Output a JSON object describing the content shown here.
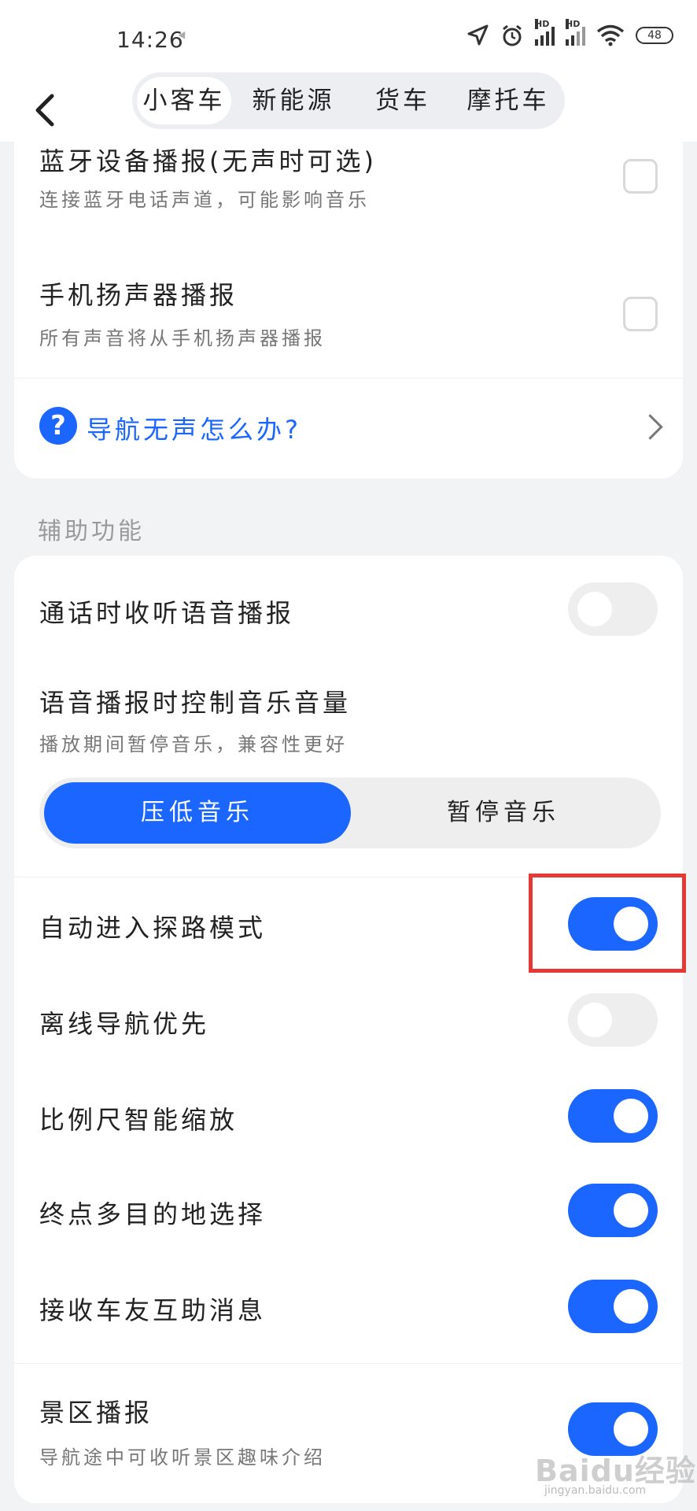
{
  "status_bar": {
    "time": "14:26",
    "battery": "48",
    "hd_label": "HD"
  },
  "tabs": [
    {
      "label": "小客车",
      "active": true
    },
    {
      "label": "新能源",
      "active": false
    },
    {
      "label": "货车",
      "active": false
    },
    {
      "label": "摩托车",
      "active": false
    }
  ],
  "sound_card": {
    "bluetooth": {
      "title": "蓝牙设备播报(无声时可选)",
      "subtitle": "连接蓝牙电话声道，可能影响音乐",
      "checked": false
    },
    "speaker": {
      "title": "手机扬声器播报",
      "subtitle": "所有声音将从手机扬声器播报",
      "checked": false
    },
    "help": {
      "icon_text": "?",
      "label": "导航无声怎么办?"
    }
  },
  "assist_section": {
    "label": "辅助功能",
    "call_voice": {
      "title": "通话时收听语音播报",
      "on": false
    },
    "music_control": {
      "title": "语音播报时控制音乐音量",
      "subtitle": "播放期间暂停音乐，兼容性更好",
      "options": [
        "压低音乐",
        "暂停音乐"
      ],
      "selected": "压低音乐"
    },
    "auto_explore": {
      "title": "自动进入探路模式",
      "on": true
    },
    "offline_nav": {
      "title": "离线导航优先",
      "on": false
    },
    "scale_zoom": {
      "title": "比例尺智能缩放",
      "on": true
    },
    "multi_dest": {
      "title": "终点多目的地选择",
      "on": true
    },
    "car_friend": {
      "title": "接收车友互助消息",
      "on": true
    },
    "scenic": {
      "title": "景区播报",
      "subtitle": "导航途中可收听景区趣味介绍",
      "on": true
    }
  },
  "watermark": {
    "text": "Baidu经验",
    "url": "jingyan.baidu.com"
  },
  "colors": {
    "accent": "#1a66ff",
    "highlight": "#e53935",
    "background": "#f2f3f5"
  }
}
